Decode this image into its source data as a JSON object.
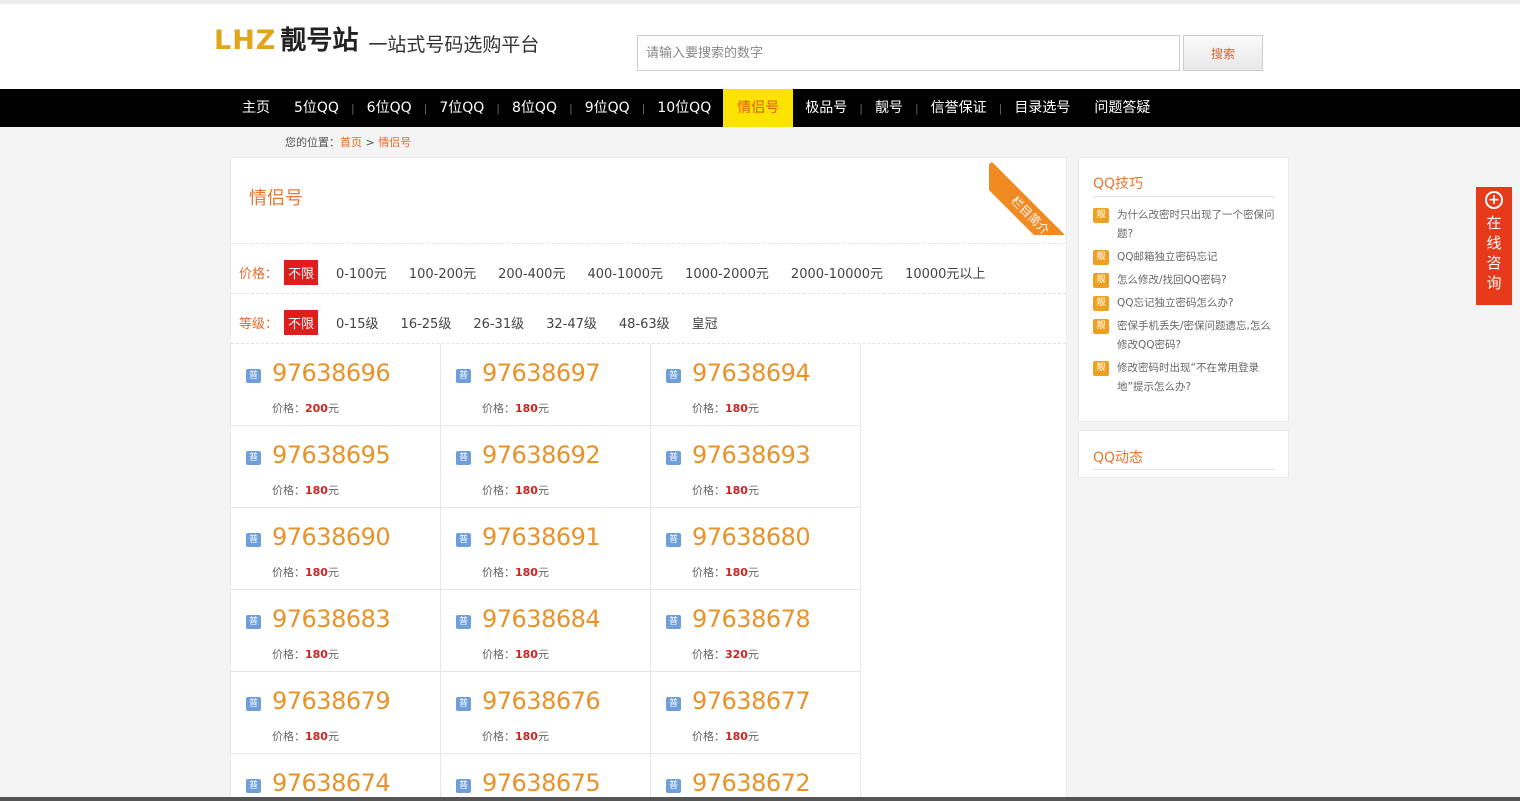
{
  "header": {
    "logo_latin": "LHZ",
    "logo_cn": "靓号站",
    "slogan": "一站式号码选购平台",
    "search_placeholder": "请输入要搜索的数字",
    "search_button": "搜索"
  },
  "nav": [
    "主页",
    "5位QQ",
    "6位QQ",
    "7位QQ",
    "8位QQ",
    "9位QQ",
    "10位QQ",
    "情侣号",
    "极品号",
    "靓号",
    "信誉保证",
    "目录选号",
    "问题答疑"
  ],
  "nav_active": "情侣号",
  "breadcrumb": {
    "prefix": "您的位置：",
    "home": "首页",
    "sep": ">",
    "current": "情侣号"
  },
  "main": {
    "title": "情侣号",
    "ribbon": "栏目简介",
    "price_filter": {
      "label": "价格：",
      "options": [
        "不限",
        "0-100元",
        "100-200元",
        "200-400元",
        "400-1000元",
        "1000-2000元",
        "2000-10000元",
        "10000元以上"
      ]
    },
    "level_filter": {
      "label": "等级：",
      "options": [
        "不限",
        "0-15级",
        "16-25级",
        "26-31级",
        "32-47级",
        "48-63级",
        "皇冠"
      ]
    },
    "badge": "普",
    "price_prefix": "价格：",
    "price_unit": "元",
    "numbers": [
      {
        "num": "97638696",
        "price": "200"
      },
      {
        "num": "97638697",
        "price": "180"
      },
      {
        "num": "97638694",
        "price": "180"
      },
      {
        "num": "97638695",
        "price": "180"
      },
      {
        "num": "97638692",
        "price": "180"
      },
      {
        "num": "97638693",
        "price": "180"
      },
      {
        "num": "97638690",
        "price": "180"
      },
      {
        "num": "97638691",
        "price": "180"
      },
      {
        "num": "97638680",
        "price": "180"
      },
      {
        "num": "97638683",
        "price": "180"
      },
      {
        "num": "97638684",
        "price": "180"
      },
      {
        "num": "97638678",
        "price": "320"
      },
      {
        "num": "97638679",
        "price": "180"
      },
      {
        "num": "97638676",
        "price": "180"
      },
      {
        "num": "97638677",
        "price": "180"
      },
      {
        "num": "97638674",
        "price": ""
      },
      {
        "num": "97638675",
        "price": ""
      },
      {
        "num": "97638672",
        "price": ""
      }
    ]
  },
  "sidebar": {
    "tips_title": "QQ技巧",
    "tip_badge": "靓",
    "tips": [
      "为什么改密时只出现了一个密保问题?",
      "QQ邮箱独立密码忘记",
      "怎么修改/找回QQ密码?",
      "QQ忘记独立密码怎么办?",
      "密保手机丢失/密保问题遗忘,怎么修改QQ密码?",
      "修改密码时出现“不在常用登录地”提示怎么办?"
    ],
    "news_title": "QQ动态"
  },
  "consult": {
    "text": "在线咨询"
  }
}
